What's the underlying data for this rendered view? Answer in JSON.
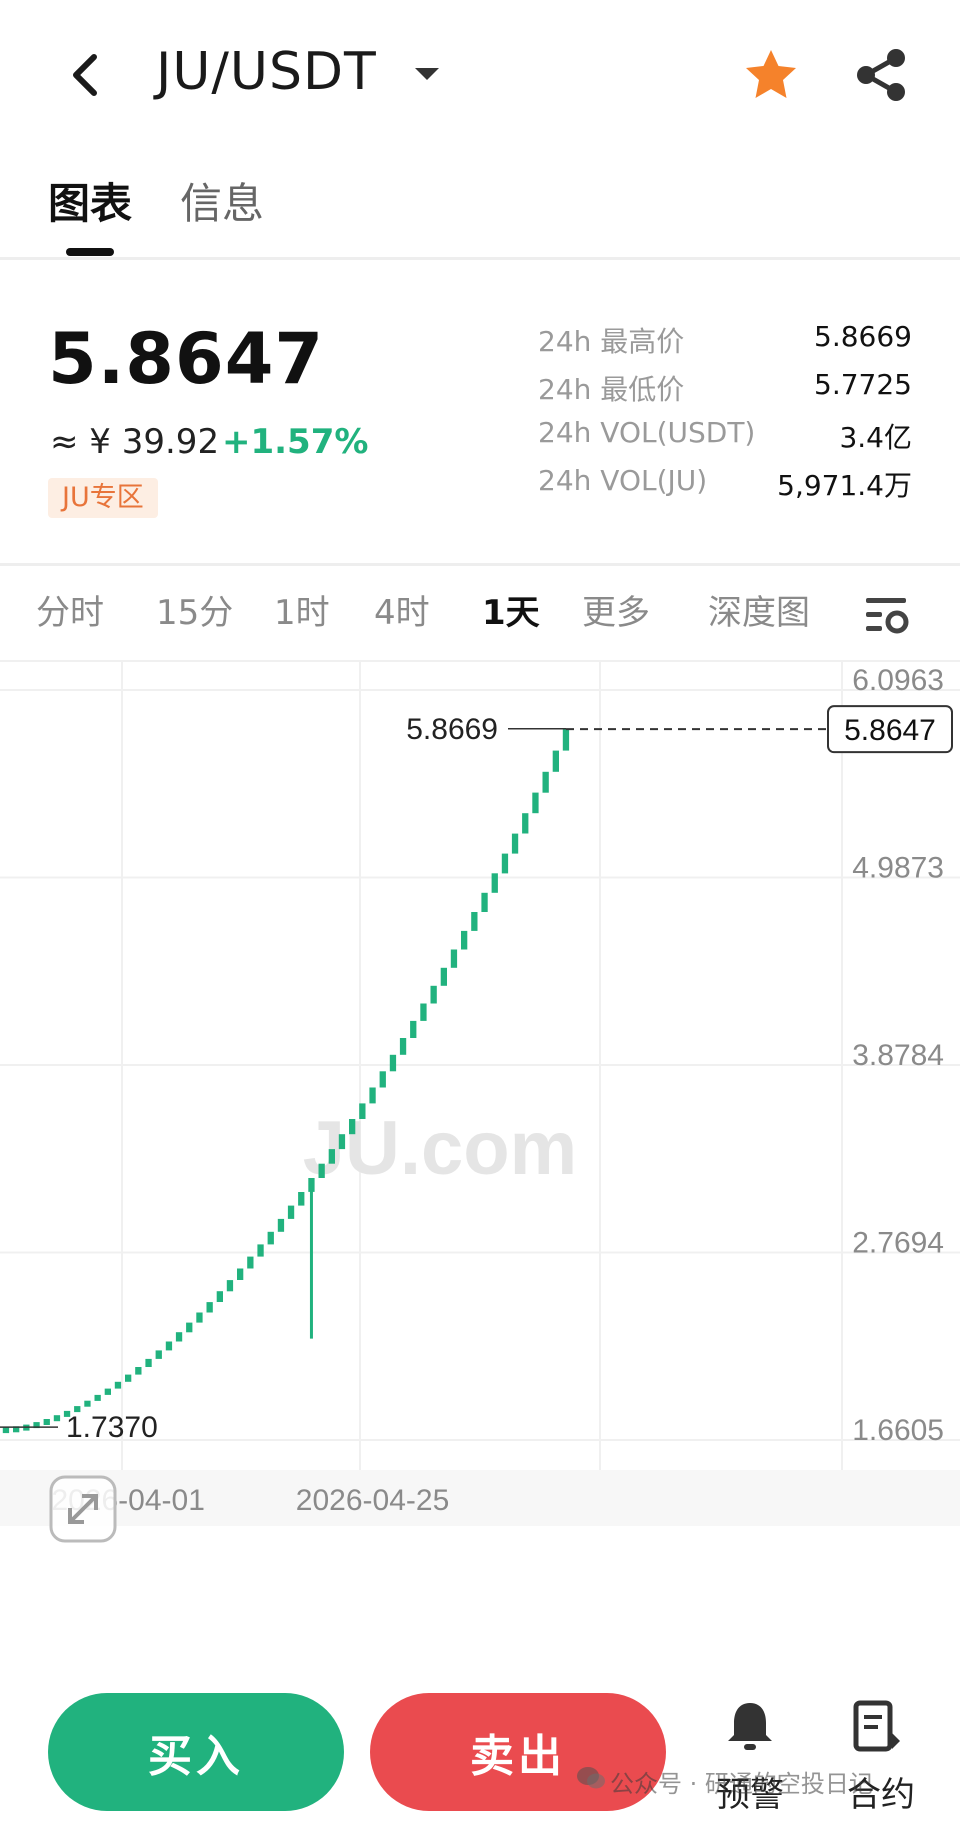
{
  "header": {
    "title": "JU/USDT",
    "icons": [
      "back-arrow-icon",
      "dropdown-caret-icon",
      "star-icon",
      "share-icon"
    ],
    "star_color": "#f5822b"
  },
  "tabs": [
    {
      "label": "图表",
      "active": true
    },
    {
      "label": "信息",
      "active": false
    }
  ],
  "price": {
    "last": "5.8647",
    "cny": "≈ ¥ 39.92",
    "change": "+1.57%",
    "change_color": "#21b27e",
    "zone_badge": "JU专区"
  },
  "stats": [
    {
      "label": "24h 最高价",
      "value": "5.8669"
    },
    {
      "label": "24h 最低价",
      "value": "5.7725"
    },
    {
      "label": "24h VOL(USDT)",
      "value": "3.4亿"
    },
    {
      "label": "24h VOL(JU)",
      "value": "5,971.4万"
    }
  ],
  "intervals": [
    {
      "label": "分时",
      "active": false
    },
    {
      "label": "15分",
      "active": false
    },
    {
      "label": "1时",
      "active": false
    },
    {
      "label": "4时",
      "active": false
    },
    {
      "label": "1天",
      "active": true
    },
    {
      "label": "更多",
      "active": false
    },
    {
      "label": "深度图",
      "active": false
    }
  ],
  "chart": {
    "watermark": "JU.com",
    "y_ticks": [
      "6.0963",
      "4.9873",
      "3.8784",
      "2.7694",
      "1.6605"
    ],
    "x_ticks": [
      "2026-04-01",
      "2026-04-25"
    ],
    "high_label": "5.8669",
    "low_label": "1.7370",
    "last_price_tag": "5.8647"
  },
  "chart_data": {
    "type": "candlestick",
    "ylim": [
      1.6605,
      6.0963
    ],
    "y_ticks": [
      6.0963,
      4.9873,
      3.8784,
      2.7694,
      1.6605
    ],
    "x_ticks": [
      "2026-04-01",
      "2026-04-25"
    ],
    "marked_high": 5.8669,
    "marked_low": 1.737,
    "last_price": 5.8647,
    "up_color": "#21b27e",
    "series": [
      {
        "x_start": "2026-03-20",
        "x_end": "2026-05-14",
        "close_start": 1.737,
        "close_end": 5.8647,
        "wick_low_on": "2026-04-19",
        "wick_low_value": 2.26
      }
    ]
  },
  "bottom": {
    "buy_label": "买入",
    "sell_label": "卖出",
    "buy_color": "#21b27e",
    "sell_color": "#ea4b4f",
    "alert_label": "预警",
    "contract_label": "合约",
    "watermark_text": "公众号 · 研通的空投日记"
  }
}
